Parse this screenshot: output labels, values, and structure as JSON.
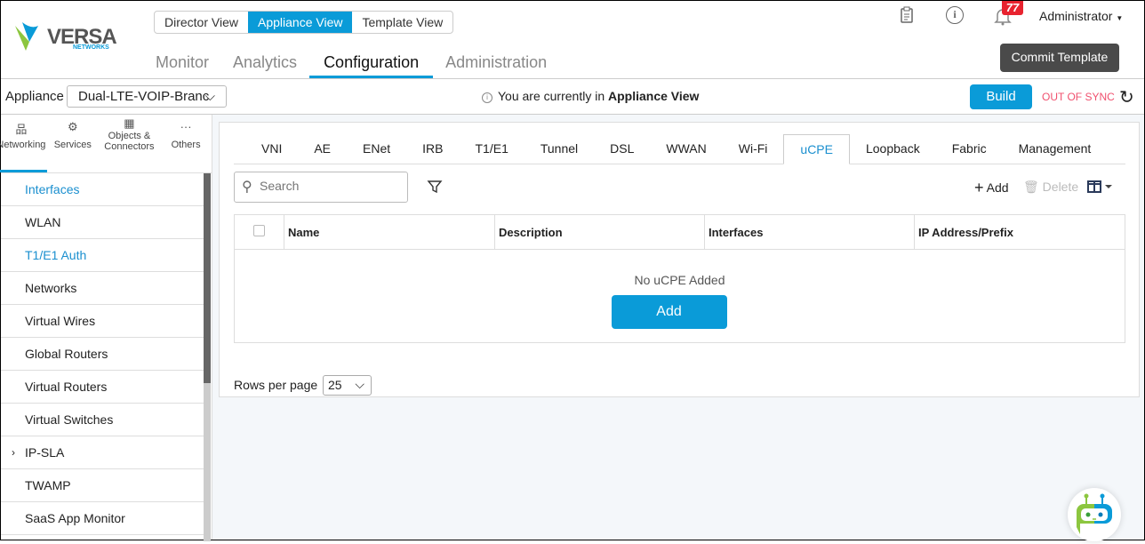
{
  "brand": {
    "name": "VERSA",
    "sub": "NETWORKS"
  },
  "views": [
    "Director View",
    "Appliance View",
    "Template View"
  ],
  "active_view": "Appliance View",
  "nav": [
    "Monitor",
    "Analytics",
    "Configuration",
    "Administration"
  ],
  "active_nav": "Configuration",
  "header": {
    "notification_count": "77",
    "user": "Administrator",
    "commit_label": "Commit Template"
  },
  "appliance_bar": {
    "label": "Appliance",
    "selected": "Dual-LTE-VOIP-Branc",
    "info_prefix": "You are currently in ",
    "info_bold": "Appliance View",
    "build_label": "Build",
    "sync_status": "OUT OF SYNC"
  },
  "side_tabs": [
    {
      "label": "Networking",
      "icon": "network-icon"
    },
    {
      "label": "Services",
      "icon": "gears-icon"
    },
    {
      "label": "Objects & Connectors",
      "icon": "grid-icon"
    },
    {
      "label": "Others",
      "icon": "more-icon"
    }
  ],
  "side_items": [
    "Interfaces",
    "WLAN",
    "T1/E1 Auth",
    "Networks",
    "Virtual Wires",
    "Global Routers",
    "Virtual Routers",
    "Virtual Switches",
    "IP-SLA",
    "TWAMP",
    "SaaS App Monitor"
  ],
  "tabs": [
    "VNI",
    "AE",
    "ENet",
    "IRB",
    "T1/E1",
    "Tunnel",
    "DSL",
    "WWAN",
    "Wi-Fi",
    "uCPE",
    "Loopback",
    "Fabric",
    "Management"
  ],
  "active_tab": "uCPE",
  "toolbar": {
    "search_placeholder": "Search",
    "add_label": "Add",
    "delete_label": "Delete"
  },
  "table": {
    "columns": [
      "Name",
      "Description",
      "Interfaces",
      "IP Address/Prefix"
    ],
    "empty_text": "No uCPE Added",
    "add_label": "Add"
  },
  "pagination": {
    "label": "Rows per page",
    "value": "25"
  },
  "colors": {
    "accent": "#0a9bd8",
    "out_of_sync": "#f0506e",
    "commit_bg": "#4a4a4a",
    "badge": "#e8232f"
  }
}
